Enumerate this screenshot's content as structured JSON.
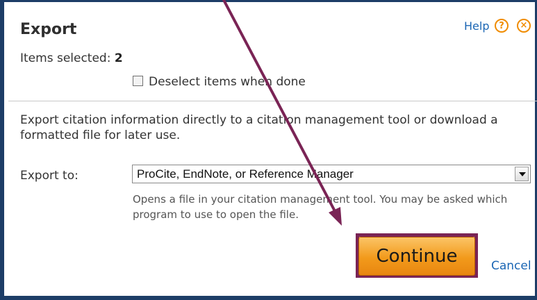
{
  "dialog": {
    "title": "Export",
    "help_label": "Help",
    "help_icon_glyph": "?",
    "close_icon_glyph": "×",
    "items_selected_label": "Items selected:",
    "items_selected_count": "2",
    "deselect_label": "Deselect items when done",
    "deselect_checked": false,
    "description": "Export citation information directly to a citation management tool or download a formatted file for later use.",
    "export_to_label": "Export to:",
    "export_to_selected": "ProCite, EndNote, or Reference Manager",
    "export_note": "Opens a file in your citation management tool. You may be asked which program to use to open the file.",
    "continue_label": "Continue",
    "cancel_label": "Cancel"
  },
  "colors": {
    "border": "#1d3d67",
    "link": "#1b66b4",
    "accent_orange": "#f29a1b",
    "annotation": "#7a2455"
  },
  "icons": [
    "help-icon",
    "close-icon",
    "dropdown-arrow-icon"
  ]
}
